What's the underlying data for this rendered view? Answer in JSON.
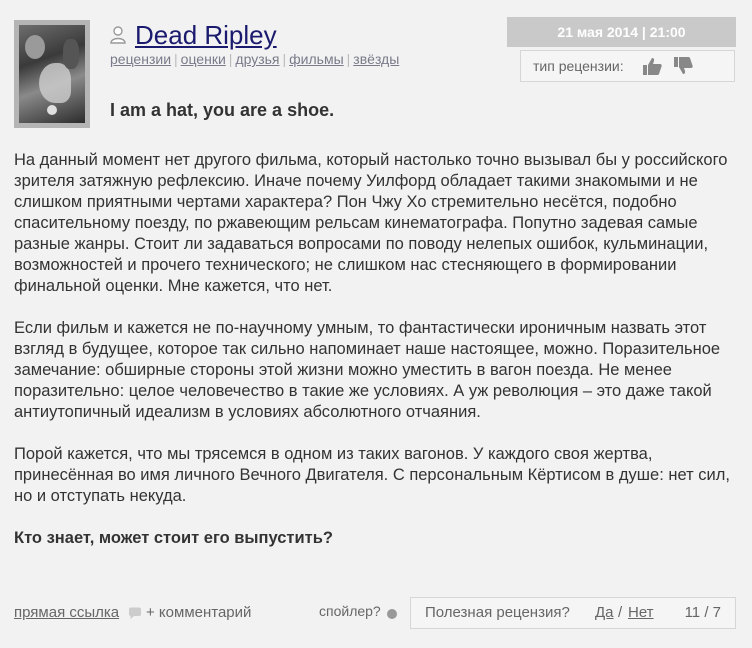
{
  "author": {
    "username": "Dead Ripley",
    "nav": [
      "рецензии",
      "оценки",
      "друзья",
      "фильмы",
      "звёзды"
    ]
  },
  "meta": {
    "datetime": "21 мая 2014 | 21:00",
    "review_type_label": "тип рецензии:"
  },
  "review": {
    "title": "I am a hat, you are a shoe.",
    "paragraphs": [
      "На данный момент нет другого фильма, который настолько точно вызывал бы у российского зрителя затяжную рефлексию. Иначе почему Уилфорд обладает такими знакомыми и не слишком приятными чертами характера? Пон Чжу Хо стремительно несётся, подобно спасительному поезду, по ржавеющим рельсам кинематографа. Попутно задевая самые разные жанры. Стоит ли задаваться вопросами по поводу нелепых ошибок, кульминации, возможностей и прочего технического; не слишком нас стесняющего в формировании финальной оценки. Мне кажется, что нет.",
      "Если фильм и кажется не по-научному умным, то фантастически ироничным назвать этот взгляд в будущее, которое так сильно напоминает наше настоящее, можно. Поразительное замечание: обширные стороны этой жизни можно уместить в вагон поезда. Не менее поразительно: целое человечество в такие же условиях. А уж революция – это даже такой антиутопичный идеализм в условиях абсолютного отчаяния.",
      "Порой кажется, что мы трясемся в одном из таких вагонов. У каждого своя жертва, принесённая во имя личного Вечного Двигателя. С персональным Кёртисом в душе: нет сил, но и отступать некуда."
    ],
    "closing": "Кто знает, может стоит его выпустить?"
  },
  "footer": {
    "direct_link": "прямая ссылка",
    "comment": "+ комментарий",
    "spoiler": "спойлер?",
    "useful_question": "Полезная рецензия?",
    "yes": "Да",
    "slash": "/",
    "no": "Нет",
    "score": "11 / 7"
  },
  "icons": {
    "user": "user-icon",
    "thumb_up": "thumb-up-icon",
    "thumb_down": "thumb-down-icon",
    "comment": "comment-icon",
    "spoiler": "spoiler-dot-icon"
  },
  "colors": {
    "background": "#f2f2f2",
    "username": "#1a1a6e",
    "date_bar": "#c9c9c9",
    "text": "#333333",
    "muted": "#666666"
  }
}
